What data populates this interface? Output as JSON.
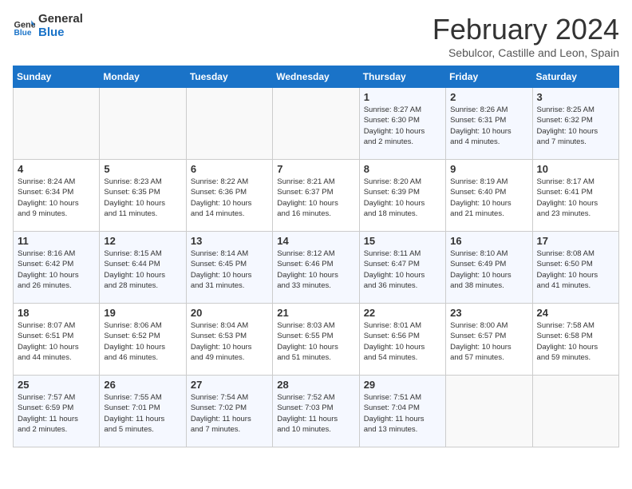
{
  "header": {
    "logo_line1": "General",
    "logo_line2": "Blue",
    "month_title": "February 2024",
    "subtitle": "Sebulcor, Castille and Leon, Spain"
  },
  "weekdays": [
    "Sunday",
    "Monday",
    "Tuesday",
    "Wednesday",
    "Thursday",
    "Friday",
    "Saturday"
  ],
  "weeks": [
    [
      {
        "day": "",
        "info": ""
      },
      {
        "day": "",
        "info": ""
      },
      {
        "day": "",
        "info": ""
      },
      {
        "day": "",
        "info": ""
      },
      {
        "day": "1",
        "info": "Sunrise: 8:27 AM\nSunset: 6:30 PM\nDaylight: 10 hours\nand 2 minutes."
      },
      {
        "day": "2",
        "info": "Sunrise: 8:26 AM\nSunset: 6:31 PM\nDaylight: 10 hours\nand 4 minutes."
      },
      {
        "day": "3",
        "info": "Sunrise: 8:25 AM\nSunset: 6:32 PM\nDaylight: 10 hours\nand 7 minutes."
      }
    ],
    [
      {
        "day": "4",
        "info": "Sunrise: 8:24 AM\nSunset: 6:34 PM\nDaylight: 10 hours\nand 9 minutes."
      },
      {
        "day": "5",
        "info": "Sunrise: 8:23 AM\nSunset: 6:35 PM\nDaylight: 10 hours\nand 11 minutes."
      },
      {
        "day": "6",
        "info": "Sunrise: 8:22 AM\nSunset: 6:36 PM\nDaylight: 10 hours\nand 14 minutes."
      },
      {
        "day": "7",
        "info": "Sunrise: 8:21 AM\nSunset: 6:37 PM\nDaylight: 10 hours\nand 16 minutes."
      },
      {
        "day": "8",
        "info": "Sunrise: 8:20 AM\nSunset: 6:39 PM\nDaylight: 10 hours\nand 18 minutes."
      },
      {
        "day": "9",
        "info": "Sunrise: 8:19 AM\nSunset: 6:40 PM\nDaylight: 10 hours\nand 21 minutes."
      },
      {
        "day": "10",
        "info": "Sunrise: 8:17 AM\nSunset: 6:41 PM\nDaylight: 10 hours\nand 23 minutes."
      }
    ],
    [
      {
        "day": "11",
        "info": "Sunrise: 8:16 AM\nSunset: 6:42 PM\nDaylight: 10 hours\nand 26 minutes."
      },
      {
        "day": "12",
        "info": "Sunrise: 8:15 AM\nSunset: 6:44 PM\nDaylight: 10 hours\nand 28 minutes."
      },
      {
        "day": "13",
        "info": "Sunrise: 8:14 AM\nSunset: 6:45 PM\nDaylight: 10 hours\nand 31 minutes."
      },
      {
        "day": "14",
        "info": "Sunrise: 8:12 AM\nSunset: 6:46 PM\nDaylight: 10 hours\nand 33 minutes."
      },
      {
        "day": "15",
        "info": "Sunrise: 8:11 AM\nSunset: 6:47 PM\nDaylight: 10 hours\nand 36 minutes."
      },
      {
        "day": "16",
        "info": "Sunrise: 8:10 AM\nSunset: 6:49 PM\nDaylight: 10 hours\nand 38 minutes."
      },
      {
        "day": "17",
        "info": "Sunrise: 8:08 AM\nSunset: 6:50 PM\nDaylight: 10 hours\nand 41 minutes."
      }
    ],
    [
      {
        "day": "18",
        "info": "Sunrise: 8:07 AM\nSunset: 6:51 PM\nDaylight: 10 hours\nand 44 minutes."
      },
      {
        "day": "19",
        "info": "Sunrise: 8:06 AM\nSunset: 6:52 PM\nDaylight: 10 hours\nand 46 minutes."
      },
      {
        "day": "20",
        "info": "Sunrise: 8:04 AM\nSunset: 6:53 PM\nDaylight: 10 hours\nand 49 minutes."
      },
      {
        "day": "21",
        "info": "Sunrise: 8:03 AM\nSunset: 6:55 PM\nDaylight: 10 hours\nand 51 minutes."
      },
      {
        "day": "22",
        "info": "Sunrise: 8:01 AM\nSunset: 6:56 PM\nDaylight: 10 hours\nand 54 minutes."
      },
      {
        "day": "23",
        "info": "Sunrise: 8:00 AM\nSunset: 6:57 PM\nDaylight: 10 hours\nand 57 minutes."
      },
      {
        "day": "24",
        "info": "Sunrise: 7:58 AM\nSunset: 6:58 PM\nDaylight: 10 hours\nand 59 minutes."
      }
    ],
    [
      {
        "day": "25",
        "info": "Sunrise: 7:57 AM\nSunset: 6:59 PM\nDaylight: 11 hours\nand 2 minutes."
      },
      {
        "day": "26",
        "info": "Sunrise: 7:55 AM\nSunset: 7:01 PM\nDaylight: 11 hours\nand 5 minutes."
      },
      {
        "day": "27",
        "info": "Sunrise: 7:54 AM\nSunset: 7:02 PM\nDaylight: 11 hours\nand 7 minutes."
      },
      {
        "day": "28",
        "info": "Sunrise: 7:52 AM\nSunset: 7:03 PM\nDaylight: 11 hours\nand 10 minutes."
      },
      {
        "day": "29",
        "info": "Sunrise: 7:51 AM\nSunset: 7:04 PM\nDaylight: 11 hours\nand 13 minutes."
      },
      {
        "day": "",
        "info": ""
      },
      {
        "day": "",
        "info": ""
      }
    ]
  ]
}
